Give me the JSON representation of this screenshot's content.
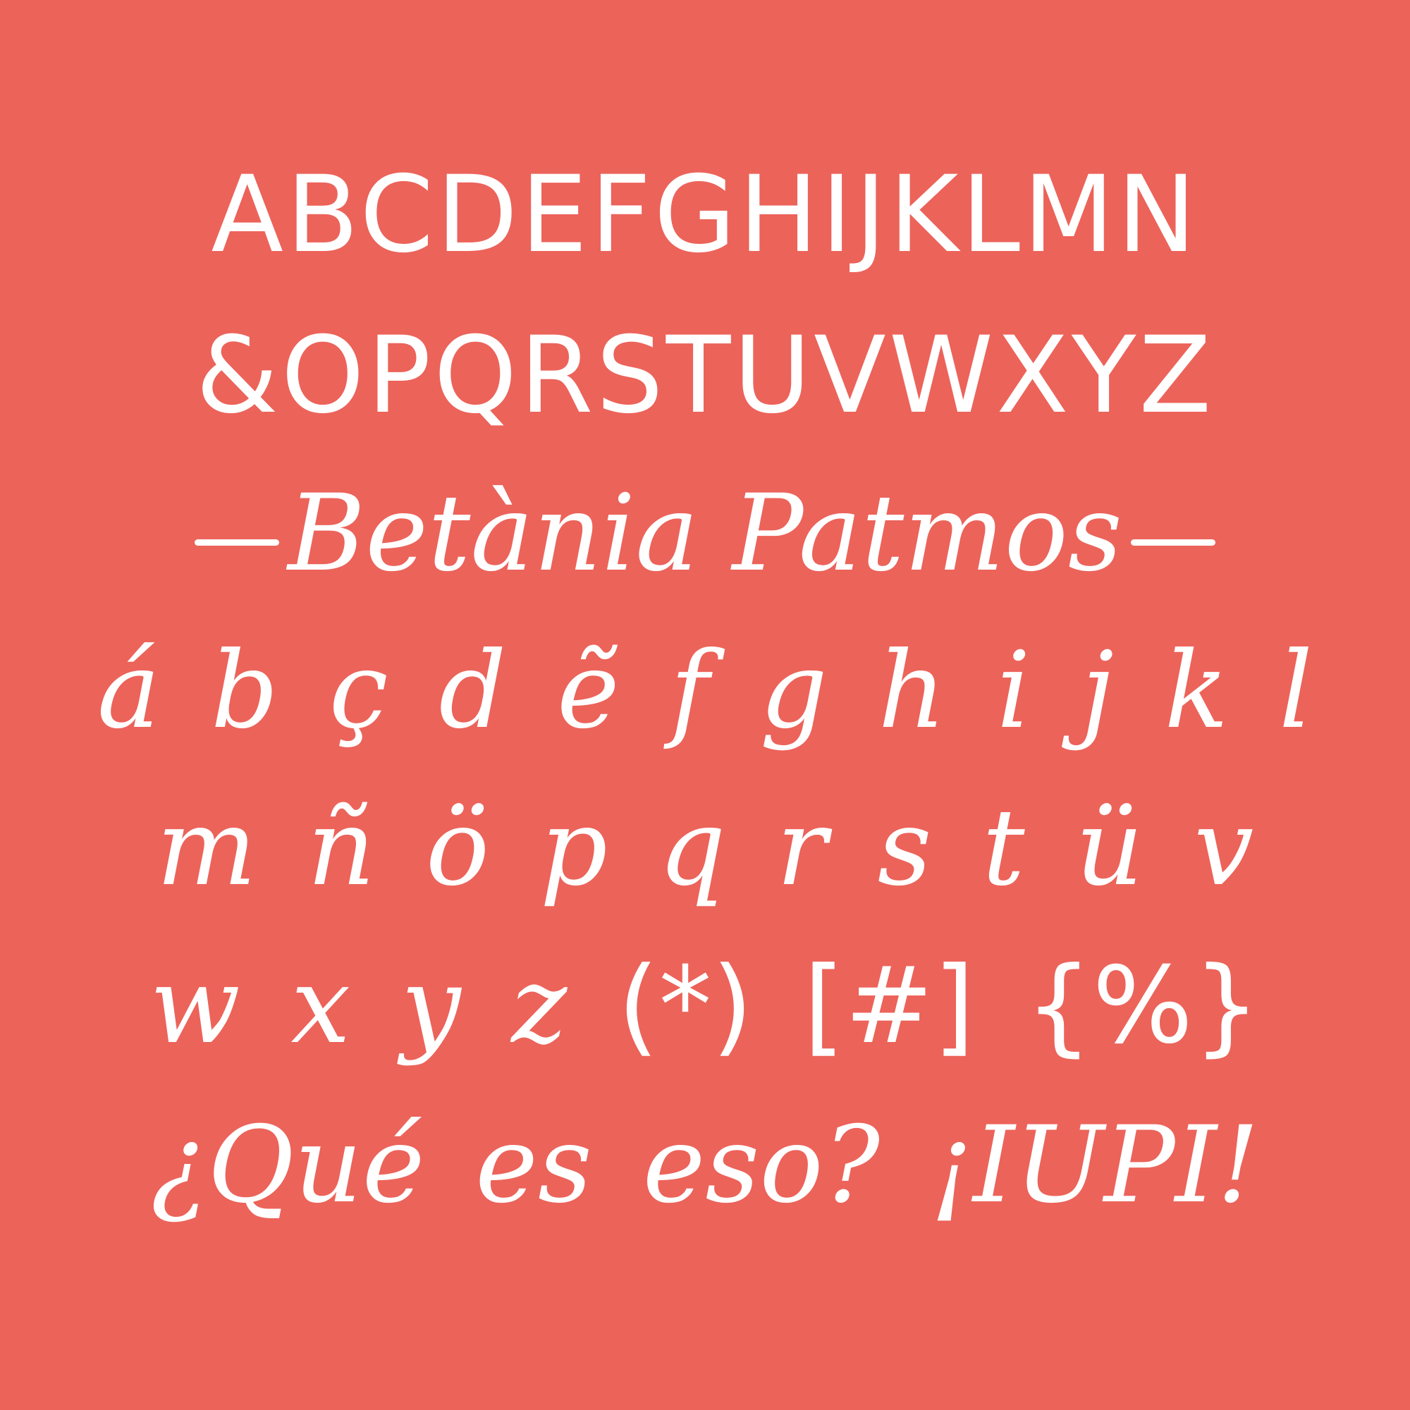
{
  "background_color": "#ec635a",
  "text_color": "#ffffff",
  "specimen": {
    "uppercase_row_1": "ABCDEFGHIJKLMN",
    "uppercase_row_2": "&OPQRSTUVWXYZ",
    "font_name": "Betània Patmos",
    "lowercase_row_1": "á b ç d ẽ f g h i j k l",
    "lowercase_row_2": "m ñ ö p q r s t ü v",
    "lowercase_row_3": "w x y z",
    "symbols": "(*) [#] {%}",
    "sample_phrase": "¿Qué es eso? ¡IUPI!"
  }
}
